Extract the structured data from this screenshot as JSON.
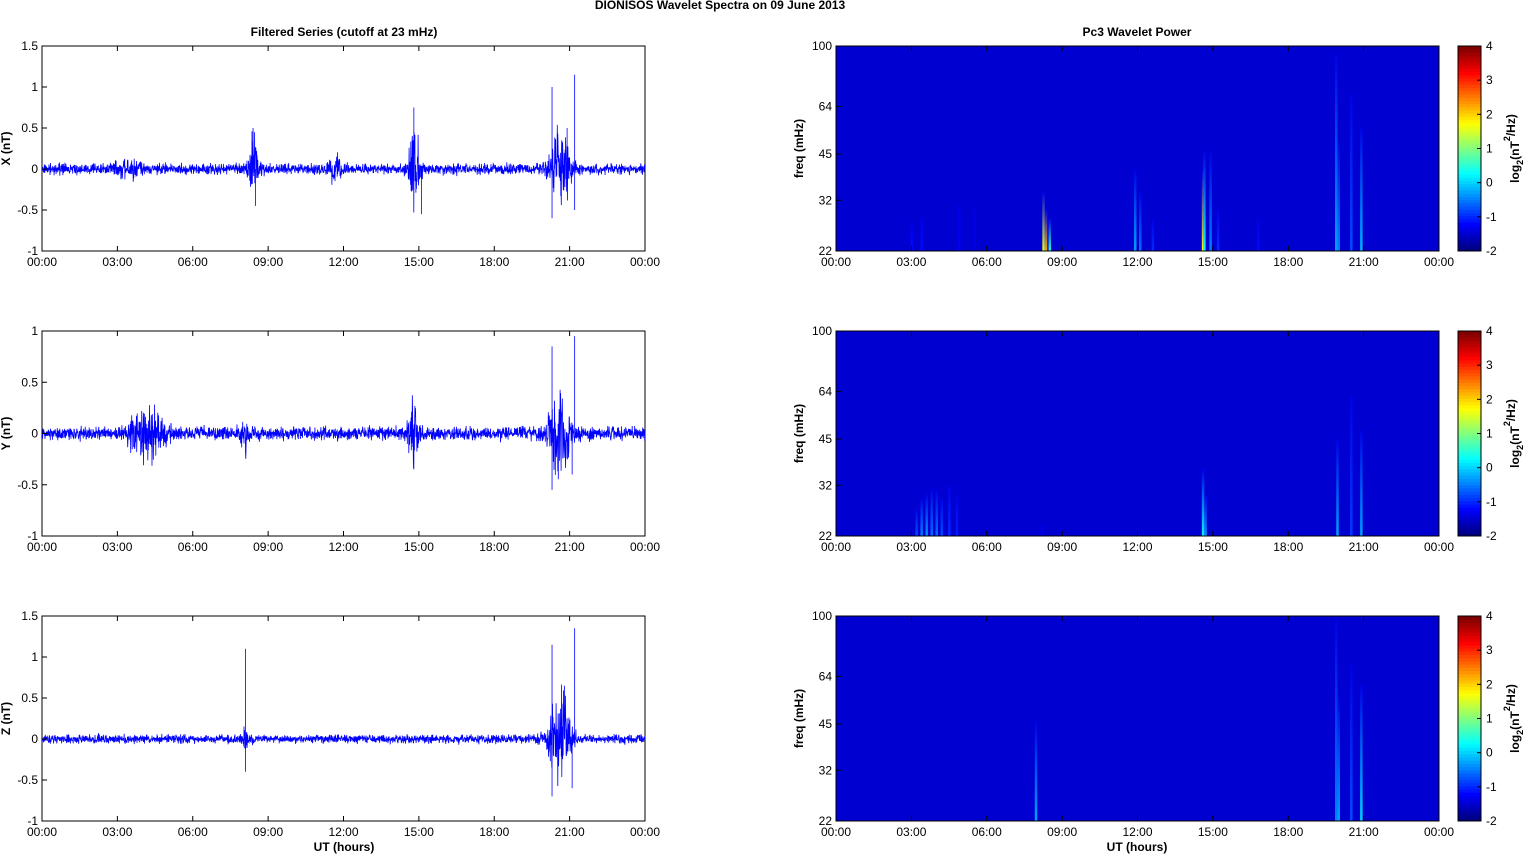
{
  "chart_data": {
    "title": "DIONISOS Wavelet Spectra on 09 June      2013",
    "left_title": "Filtered Series (cutoff at 23 mHz)",
    "right_title": "Pc3 Wavelet Power",
    "xlabel": "UT (hours)",
    "xticks": [
      "00:00",
      "03:00",
      "06:00",
      "09:00",
      "12:00",
      "15:00",
      "18:00",
      "21:00",
      "00:00"
    ],
    "xlim": [
      0,
      24
    ],
    "colorbar": {
      "label": "log2(nT2/Hz)",
      "range": [
        -2,
        4
      ],
      "ticks": [
        "4",
        "3",
        "2",
        "1",
        "0",
        "-1",
        "-2"
      ],
      "colormap": "jet"
    },
    "series": [
      {
        "type": "line",
        "name": "X",
        "ylabel": "X (nT)",
        "ylim": [
          -1,
          1.5
        ],
        "yticks": [
          "1.5",
          "1",
          "0.5",
          "0",
          "-0.5",
          "-1"
        ],
        "color": "#0000ff",
        "noise": 0.05,
        "bursts": [
          [
            3.5,
            1.0,
            0.06
          ],
          [
            8.4,
            0.4,
            0.3
          ],
          [
            11.7,
            0.4,
            0.13
          ],
          [
            14.8,
            0.4,
            0.4
          ],
          [
            20.6,
            0.8,
            0.35
          ]
        ],
        "spikes": [
          [
            8.4,
            0.5
          ],
          [
            8.5,
            -0.45
          ],
          [
            14.8,
            0.75
          ],
          [
            15.1,
            -0.55
          ],
          [
            20.3,
            1.0
          ],
          [
            20.3,
            -0.6
          ],
          [
            21.2,
            1.15
          ],
          [
            21.2,
            -0.5
          ],
          [
            20.9,
            0.5
          ]
        ]
      },
      {
        "type": "line",
        "name": "Y",
        "ylabel": "Y (nT)",
        "ylim": [
          -1,
          1
        ],
        "yticks": [
          "1",
          "0.5",
          "0",
          "-0.5",
          "-1"
        ],
        "color": "#0000ff",
        "noise": 0.05,
        "bursts": [
          [
            4.2,
            1.3,
            0.18
          ],
          [
            8.1,
            0.3,
            0.1
          ],
          [
            14.8,
            0.4,
            0.25
          ],
          [
            20.6,
            0.8,
            0.3
          ]
        ],
        "spikes": [
          [
            14.8,
            -0.35
          ],
          [
            20.3,
            0.85
          ],
          [
            20.3,
            -0.55
          ],
          [
            21.2,
            0.95
          ],
          [
            21.1,
            -0.4
          ]
        ]
      },
      {
        "type": "line",
        "name": "Z",
        "ylabel": "Z (nT)",
        "ylim": [
          -1,
          1.5
        ],
        "yticks": [
          "1.5",
          "1",
          "0.5",
          "0",
          "-0.5",
          "-1"
        ],
        "color": "#0000ff",
        "noise": 0.04,
        "bursts": [
          [
            8.1,
            0.3,
            0.08
          ],
          [
            20.6,
            0.8,
            0.45
          ]
        ],
        "spikes": [
          [
            8.1,
            1.1
          ],
          [
            8.1,
            -0.4
          ],
          [
            20.3,
            1.15
          ],
          [
            20.3,
            -0.7
          ],
          [
            21.2,
            1.35
          ],
          [
            21.1,
            -0.6
          ],
          [
            20.8,
            0.65
          ]
        ]
      }
    ],
    "spectra": [
      {
        "type": "heatmap",
        "ylabel": "freq (mHz)",
        "ylim": [
          22,
          100
        ],
        "yticks": [
          "100",
          "64",
          "45",
          "32",
          "22"
        ],
        "events": [
          [
            3.0,
            27,
            -1.2
          ],
          [
            3.4,
            28,
            -1.2
          ],
          [
            4.9,
            31,
            -1.3
          ],
          [
            5.5,
            30,
            -1.4
          ],
          [
            8.25,
            34,
            1.5
          ],
          [
            8.35,
            30,
            2.3
          ],
          [
            8.5,
            28,
            0.5
          ],
          [
            11.9,
            40,
            -0.3
          ],
          [
            12.1,
            34,
            -0.6
          ],
          [
            12.6,
            28,
            -1
          ],
          [
            14.6,
            40,
            1.8
          ],
          [
            14.65,
            46,
            0.3
          ],
          [
            14.9,
            46,
            -0.5
          ],
          [
            15.2,
            30,
            -1
          ],
          [
            16.8,
            28,
            -1.2
          ],
          [
            19.9,
            95,
            -0.3
          ],
          [
            20.0,
            50,
            -0.5
          ],
          [
            20.5,
            70,
            -0.8
          ],
          [
            20.9,
            55,
            -0.2
          ]
        ]
      },
      {
        "type": "heatmap",
        "ylabel": "freq (mHz)",
        "ylim": [
          22,
          100
        ],
        "yticks": [
          "100",
          "64",
          "45",
          "32",
          "22"
        ],
        "events": [
          [
            3.2,
            27,
            -0.8
          ],
          [
            3.4,
            29,
            -0.5
          ],
          [
            3.6,
            30,
            -0.4
          ],
          [
            3.8,
            31,
            -0.6
          ],
          [
            4.0,
            31,
            -0.6
          ],
          [
            4.2,
            29,
            -0.8
          ],
          [
            4.5,
            32,
            -1
          ],
          [
            4.8,
            30,
            -1.1
          ],
          [
            8.2,
            24,
            -1.3
          ],
          [
            14.6,
            36,
            0.2
          ],
          [
            14.7,
            30,
            -0.4
          ],
          [
            19.95,
            45,
            -0.3
          ],
          [
            20.5,
            62,
            -0.9
          ],
          [
            20.9,
            48,
            -0.3
          ]
        ]
      },
      {
        "type": "heatmap",
        "ylabel": "freq (mHz)",
        "ylim": [
          22,
          100
        ],
        "yticks": [
          "100",
          "64",
          "45",
          "32",
          "22"
        ],
        "events": [
          [
            7.95,
            46,
            -0.3
          ],
          [
            19.9,
            98,
            -0.5
          ],
          [
            20.0,
            55,
            -0.3
          ],
          [
            20.5,
            70,
            -0.8
          ],
          [
            20.9,
            60,
            0.0
          ]
        ]
      }
    ]
  }
}
